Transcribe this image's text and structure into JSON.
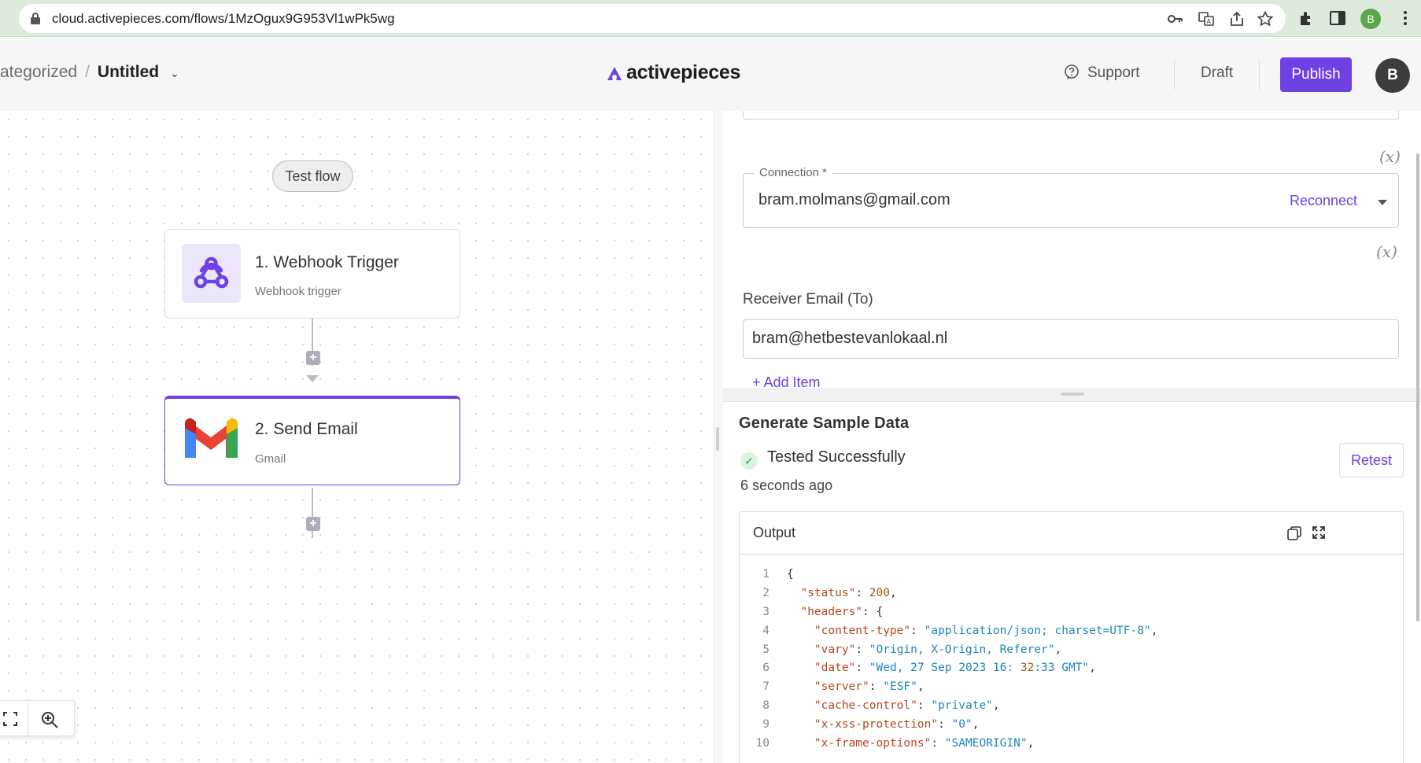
{
  "browser": {
    "url": "cloud.activepieces.com/flows/1MzOgux9G953Vl1wPk5wg",
    "profile_initial": "B"
  },
  "header": {
    "folder": "ategorized",
    "separator": "/",
    "flow_name": "Untitled",
    "logo_text": "activepieces",
    "support_label": "Support",
    "draft_label": "Draft",
    "publish_label": "Publish",
    "avatar_initial": "B",
    "brand_color": "#6e41e2"
  },
  "canvas": {
    "test_flow_label": "Test flow",
    "steps": [
      {
        "title": "1. Webhook Trigger",
        "subtitle": "Webhook trigger",
        "icon": "webhook-icon"
      },
      {
        "title": "2. Send Email",
        "subtitle": "Gmail",
        "icon": "gmail-icon"
      }
    ],
    "add_step_symbol": "+"
  },
  "settings": {
    "var_symbol": "(x)",
    "connection": {
      "legend": "Connection *",
      "value": "bram.molmans@gmail.com",
      "reconnect_label": "Reconnect"
    },
    "receiver": {
      "label": "Receiver Email (To)",
      "value": "bram@hetbestevanlokaal.nl",
      "add_item_label": "+ Add Item"
    }
  },
  "sample": {
    "title": "Generate Sample Data",
    "status": "Tested Successfully",
    "time_ago": "6 seconds ago",
    "retest_label": "Retest",
    "output_label": "Output",
    "code_lines": [
      "{",
      "  \"status\": 200,",
      "  \"headers\": {",
      "    \"content-type\": \"application/json; charset=UTF-8\",",
      "    \"vary\": \"Origin, X-Origin, Referer\",",
      "    \"date\": \"Wed, 27 Sep 2023 16:32:33 GMT\",",
      "    \"server\": \"ESF\",",
      "    \"cache-control\": \"private\",",
      "    \"x-xss-protection\": \"0\",",
      "    \"x-frame-options\": \"SAMEORIGIN\","
    ]
  }
}
